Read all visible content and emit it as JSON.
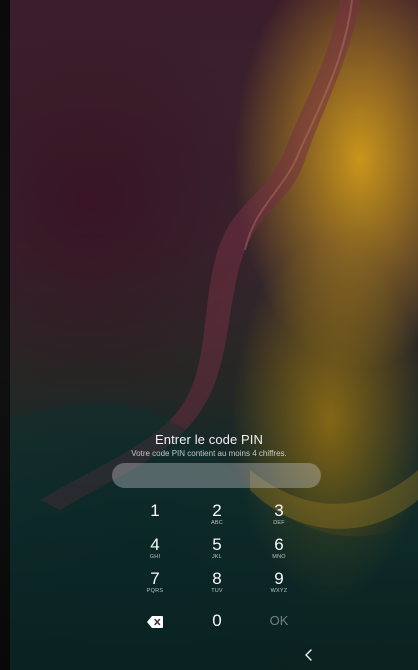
{
  "lock_screen": {
    "title": "Entrer le code PIN",
    "subtitle": "Votre code PIN contient au moins 4 chiffres.",
    "pin_value": ""
  },
  "keypad": {
    "keys": [
      {
        "digit": "1",
        "letters": ""
      },
      {
        "digit": "2",
        "letters": "ABC"
      },
      {
        "digit": "3",
        "letters": "DEF"
      },
      {
        "digit": "4",
        "letters": "GHI"
      },
      {
        "digit": "5",
        "letters": "JKL"
      },
      {
        "digit": "6",
        "letters": "MNO"
      },
      {
        "digit": "7",
        "letters": "PQRS"
      },
      {
        "digit": "8",
        "letters": "TUV"
      },
      {
        "digit": "9",
        "letters": "WXYZ"
      }
    ],
    "backspace_icon": "backspace-icon",
    "zero": "0",
    "ok_label": "OK"
  },
  "navigation": {
    "back_icon": "chevron-left-icon"
  },
  "colors": {
    "wallpaper_gold": "#d6a01a",
    "wallpaper_plum": "#3a1424",
    "wallpaper_teal": "#0a282a",
    "text_primary": "#ffffff",
    "ok_disabled": "#8a8a8a"
  }
}
